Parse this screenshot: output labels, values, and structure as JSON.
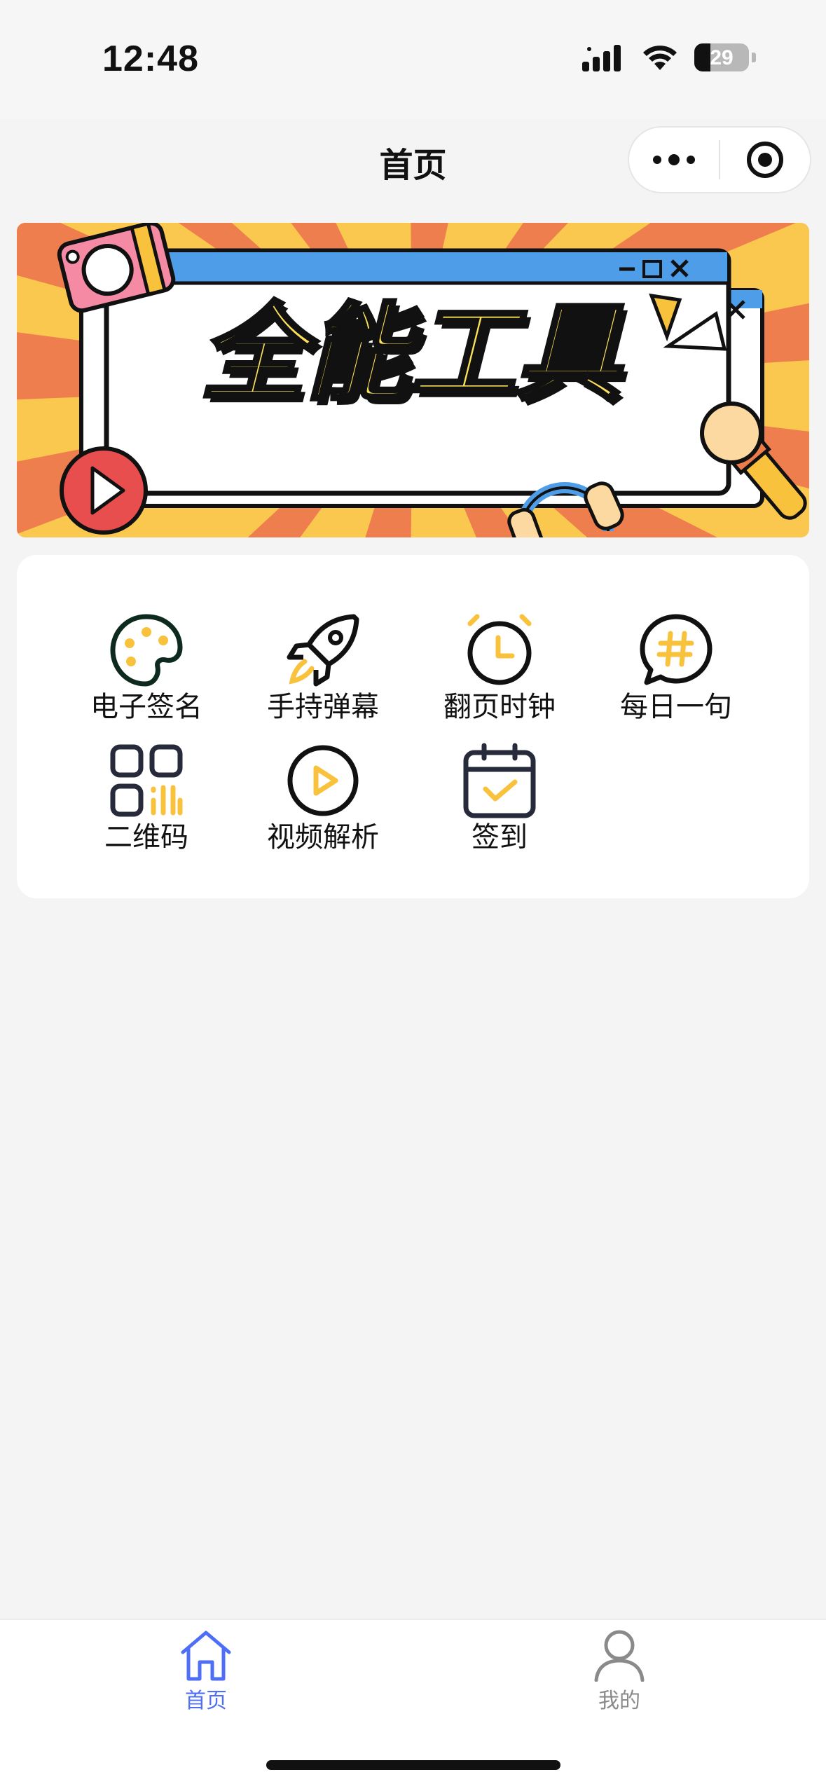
{
  "status_bar": {
    "time": "12:48",
    "battery": "29"
  },
  "nav": {
    "title": "首页"
  },
  "banner": {
    "title": "全能工具"
  },
  "tools": [
    {
      "label": "电子签名",
      "icon": "palette-icon"
    },
    {
      "label": "手持弹幕",
      "icon": "rocket-icon"
    },
    {
      "label": "翻页时钟",
      "icon": "alarm-clock-icon"
    },
    {
      "label": "每日一句",
      "icon": "hashtag-chat-icon"
    },
    {
      "label": "二维码",
      "icon": "qrcode-icon"
    },
    {
      "label": "视频解析",
      "icon": "play-circle-icon"
    },
    {
      "label": "签到",
      "icon": "calendar-check-icon"
    }
  ],
  "tabbar": {
    "items": [
      {
        "label": "首页",
        "icon": "home-icon",
        "active": true
      },
      {
        "label": "我的",
        "icon": "user-icon",
        "active": false
      }
    ]
  },
  "colors": {
    "accent": "#4f6ef7",
    "yellow": "#f9c23c",
    "orange": "#ee7b4a",
    "red": "#e94e4e",
    "blue": "#4d9de8"
  }
}
